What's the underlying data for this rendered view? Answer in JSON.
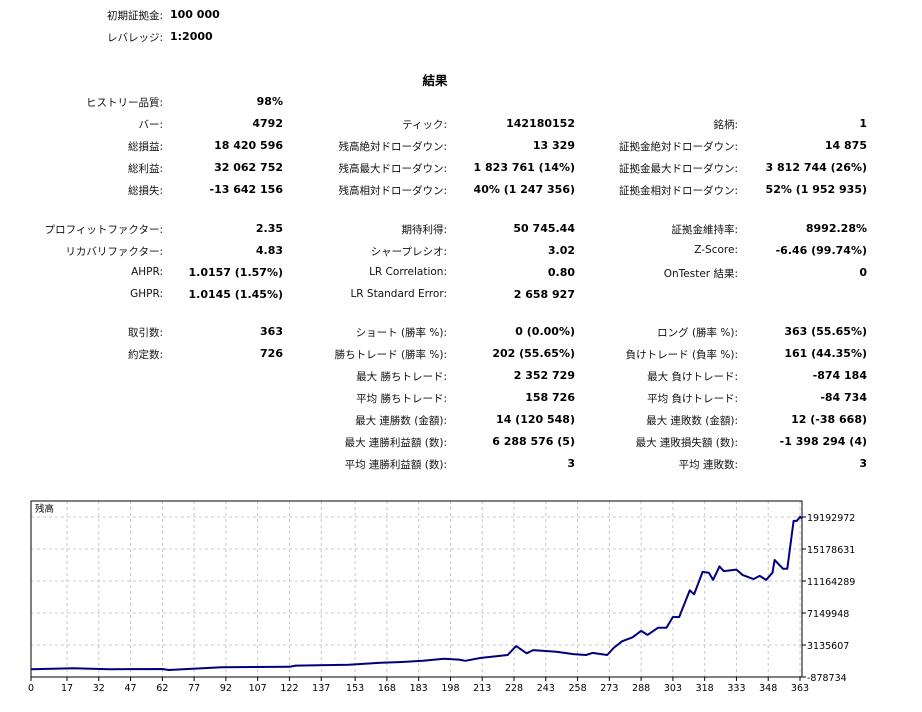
{
  "settings": [
    {
      "label": "初期証拠金:",
      "value": "100 000"
    },
    {
      "label": "レバレッジ:",
      "value": "1:2000"
    }
  ],
  "results_title": "結果",
  "rows": [
    {
      "cells": [
        [
          "ヒストリー品質:",
          "98%"
        ],
        null,
        null
      ]
    },
    {
      "cells": [
        [
          "バー:",
          "4792"
        ],
        [
          "ティック:",
          "142180152"
        ],
        [
          "銘柄:",
          "1"
        ]
      ]
    },
    {
      "cells": [
        [
          "総損益:",
          "18 420 596"
        ],
        [
          "残高絶対ドローダウン:",
          "13 329"
        ],
        [
          "証拠金絶対ドローダウン:",
          "14 875"
        ]
      ]
    },
    {
      "cells": [
        [
          "総利益:",
          "32 062 752"
        ],
        [
          "残高最大ドローダウン:",
          "1 823 761 (14%)"
        ],
        [
          "証拠金最大ドローダウン:",
          "3 812 744 (26%)"
        ]
      ]
    },
    {
      "cells": [
        [
          "総損失:",
          "-13 642 156"
        ],
        [
          "残高相対ドローダウン:",
          "40% (1 247 356)"
        ],
        [
          "証拠金相対ドローダウン:",
          "52% (1 952 935)"
        ]
      ]
    },
    {
      "cells": [
        [
          "プロフィットファクター:",
          "2.35"
        ],
        [
          "期待利得:",
          "50 745.44"
        ],
        [
          "証拠金維持率:",
          "8992.28%"
        ]
      ]
    },
    {
      "cells": [
        [
          "リカバリファクター:",
          "4.83"
        ],
        [
          "シャープレシオ:",
          "3.02"
        ],
        [
          "Z-Score:",
          "-6.46 (99.74%)"
        ]
      ]
    },
    {
      "cells": [
        [
          "AHPR:",
          "1.0157 (1.57%)"
        ],
        [
          "LR Correlation:",
          "0.80"
        ],
        [
          "OnTester 結果:",
          "0"
        ]
      ]
    },
    {
      "cells": [
        [
          "GHPR:",
          "1.0145 (1.45%)"
        ],
        [
          "LR Standard Error:",
          "2 658 927"
        ],
        null
      ]
    },
    {
      "cells": [
        [
          "取引数:",
          "363"
        ],
        [
          "ショート (勝率 %):",
          "0 (0.00%)"
        ],
        [
          "ロング (勝率 %):",
          "363 (55.65%)"
        ]
      ]
    },
    {
      "cells": [
        [
          "約定数:",
          "726"
        ],
        [
          "勝ちトレード (勝率 %):",
          "202 (55.65%)"
        ],
        [
          "負けトレード (負率 %):",
          "161 (44.35%)"
        ]
      ]
    },
    {
      "cells": [
        null,
        [
          "最大 勝ちトレード:",
          "2 352 729"
        ],
        [
          "最大 負けトレード:",
          "-874 184"
        ]
      ]
    },
    {
      "cells": [
        null,
        [
          "平均 勝ちトレード:",
          "158 726"
        ],
        [
          "平均 負けトレード:",
          "-84 734"
        ]
      ]
    },
    {
      "cells": [
        null,
        [
          "最大 連勝数 (金額):",
          "14 (120 548)"
        ],
        [
          "最大 連敗数 (金額):",
          "12 (-38 668)"
        ]
      ]
    },
    {
      "cells": [
        null,
        [
          "最大 連勝利益額 (数):",
          "6 288 576 (5)"
        ],
        [
          "最大 連敗損失額 (数):",
          "-1 398 294 (4)"
        ]
      ]
    },
    {
      "cells": [
        null,
        [
          "平均 連勝利益額 (数):",
          "3"
        ],
        [
          "平均 連敗数:",
          "3"
        ]
      ]
    }
  ],
  "chart_data": {
    "type": "line",
    "title": "残高",
    "line_color": "#00007f",
    "grid": true,
    "xlim": [
      0,
      364
    ],
    "ylim": [
      -878734,
      19192972
    ],
    "x_ticks": [
      "0",
      "17",
      "32",
      "47",
      "62",
      "77",
      "92",
      "107",
      "122",
      "137",
      "153",
      "168",
      "183",
      "198",
      "213",
      "228",
      "243",
      "258",
      "273",
      "288",
      "303",
      "318",
      "333",
      "348",
      "363"
    ],
    "y_ticks": [
      "-878734",
      "3135607",
      "7149948",
      "11164289",
      "15178631",
      "19192972"
    ],
    "series": [
      {
        "name": "残高",
        "x": [
          0,
          20,
          37,
          62,
          65,
          90,
          122,
          125,
          150,
          165,
          175,
          185,
          195,
          202,
          205,
          212,
          225,
          229,
          234,
          237,
          248,
          256,
          262,
          265,
          272,
          275,
          279,
          284,
          288,
          291,
          296,
          300,
          303,
          306,
          311,
          313,
          317,
          320,
          322,
          325,
          327,
          333,
          336,
          341,
          344,
          347,
          350,
          351,
          355,
          357,
          360,
          361.5,
          363,
          364
        ],
        "y": [
          100000,
          220000,
          100000,
          120000,
          0,
          350000,
          400000,
          550000,
          650000,
          900000,
          1000000,
          1150000,
          1400000,
          1300000,
          1150000,
          1500000,
          1880000,
          3000000,
          2100000,
          2500000,
          2300000,
          2000000,
          1880000,
          2150000,
          1880000,
          2760000,
          3600000,
          4100000,
          4900000,
          4400000,
          5300000,
          5300000,
          6650000,
          6650000,
          10000000,
          9500000,
          12300000,
          12200000,
          11300000,
          13000000,
          12400000,
          12600000,
          11900000,
          11400000,
          11800000,
          11300000,
          12200000,
          13800000,
          12700000,
          12700000,
          18700000,
          18700000,
          19200000,
          19000000
        ]
      }
    ]
  }
}
